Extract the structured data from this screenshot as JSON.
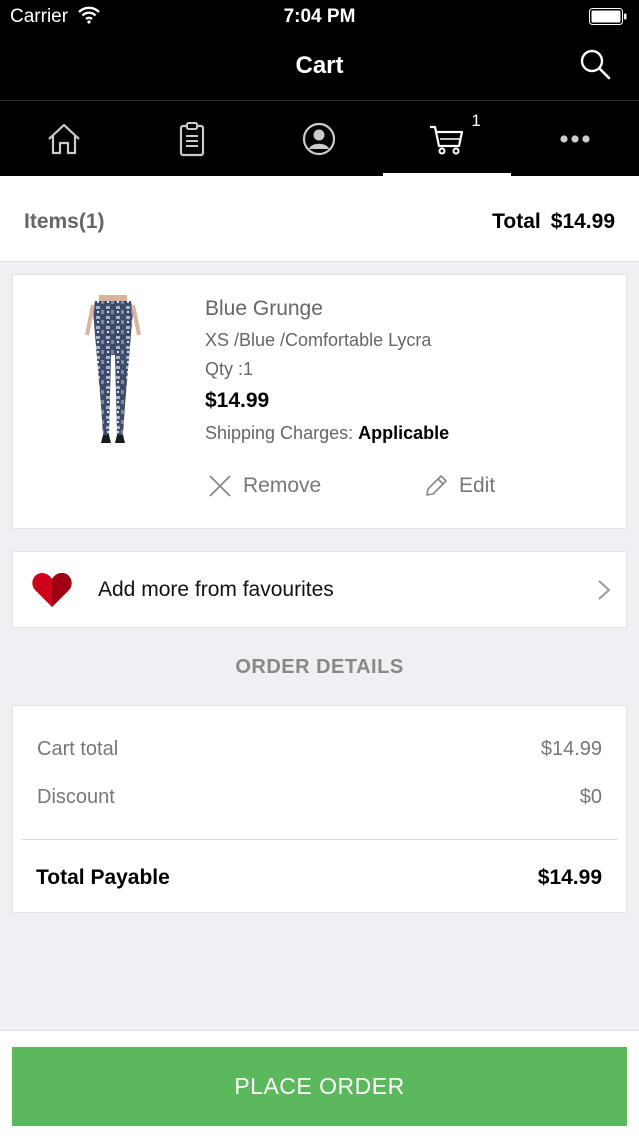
{
  "status_bar": {
    "carrier": "Carrier",
    "time": "7:04 PM"
  },
  "header": {
    "title": "Cart",
    "search_icon": "search-icon"
  },
  "tabs": [
    {
      "icon": "home-icon",
      "active": false
    },
    {
      "icon": "clipboard-icon",
      "active": false
    },
    {
      "icon": "account-icon",
      "active": false
    },
    {
      "icon": "cart-icon",
      "active": true,
      "badge": "1"
    },
    {
      "icon": "more-icon",
      "active": false
    }
  ],
  "summary": {
    "items_label": "Items",
    "items_count": "(1)",
    "total_label": "Total",
    "total_value": "$14.99"
  },
  "product": {
    "name": "Blue Grunge",
    "variant": "XS /Blue /Comfortable Lycra",
    "qty": "Qty :1",
    "price": "$14.99",
    "shipping_label": "Shipping Charges:",
    "shipping_value": "Applicable",
    "remove_label": "Remove",
    "edit_label": "Edit"
  },
  "favourites": {
    "label": "Add more from favourites"
  },
  "order_details": {
    "title": "ORDER DETAILS",
    "cart_total_label": "Cart total",
    "cart_total_value": "$14.99",
    "discount_label": "Discount",
    "discount_value": "$0",
    "payable_label": "Total Payable",
    "payable_value": "$14.99"
  },
  "actions": {
    "place_order": "PLACE ORDER"
  },
  "colors": {
    "accent_green": "#5cb85c",
    "header_black": "#000000",
    "heart_red": "#d0021b"
  }
}
